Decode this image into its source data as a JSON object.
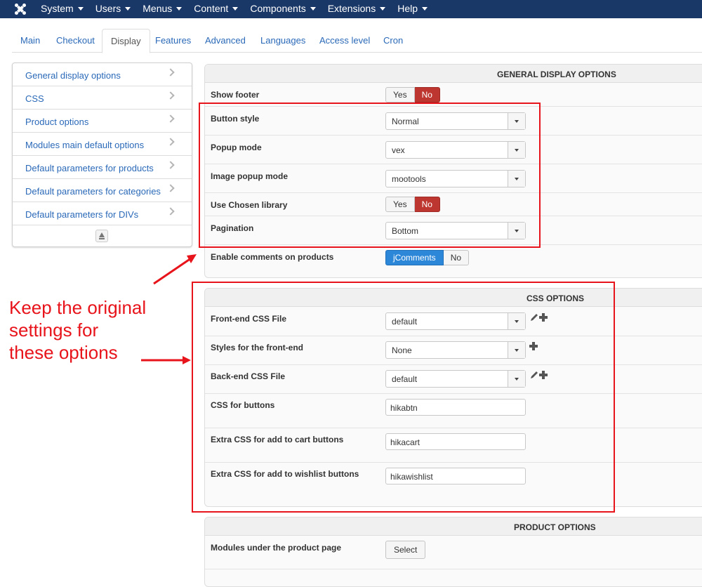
{
  "topbar": {
    "menu": [
      "System",
      "Users",
      "Menus",
      "Content",
      "Components",
      "Extensions",
      "Help"
    ]
  },
  "tabs": [
    "Main",
    "Checkout",
    "Display",
    "Features",
    "Advanced",
    "Languages",
    "Access level",
    "Cron"
  ],
  "active_tab": "Display",
  "sidebar": {
    "items": [
      "General display options",
      "CSS",
      "Product options",
      "Modules main default options",
      "Default parameters for products",
      "Default parameters for categories",
      "Default parameters for DIVs"
    ]
  },
  "general": {
    "title": "GENERAL DISPLAY OPTIONS",
    "show_footer": {
      "label": "Show footer",
      "yes": "Yes",
      "no": "No",
      "selected": "No"
    },
    "button_style": {
      "label": "Button style",
      "value": "Normal"
    },
    "popup_mode": {
      "label": "Popup mode",
      "value": "vex"
    },
    "image_popup_mode": {
      "label": "Image popup mode",
      "value": "mootools"
    },
    "use_chosen": {
      "label": "Use Chosen library",
      "yes": "Yes",
      "no": "No",
      "selected": "No"
    },
    "pagination": {
      "label": "Pagination",
      "value": "Bottom"
    },
    "enable_comments": {
      "label": "Enable comments on products",
      "opt1": "jComments",
      "opt2": "No",
      "selected": "jComments"
    }
  },
  "css": {
    "title": "CSS OPTIONS",
    "frontend_css": {
      "label": "Front-end CSS File",
      "value": "default"
    },
    "frontend_styles": {
      "label": "Styles for the front-end",
      "value": "None"
    },
    "backend_css": {
      "label": "Back-end CSS File",
      "value": "default"
    },
    "css_buttons": {
      "label": "CSS for buttons",
      "value": "hikabtn"
    },
    "css_cart": {
      "label": "Extra CSS for add to cart buttons",
      "value": "hikacart"
    },
    "css_wishlist": {
      "label": "Extra CSS for add to wishlist buttons",
      "value": "hikawishlist"
    }
  },
  "product": {
    "title": "PRODUCT OPTIONS",
    "modules_under": {
      "label": "Modules under the product page",
      "button": "Select"
    }
  },
  "annotation": {
    "lines": [
      "Keep the original",
      "settings for",
      "these options"
    ],
    "color": "#e8141b"
  },
  "colors": {
    "topbar": "#1a3867",
    "link": "#2a69b8",
    "no_active": "#bd362f",
    "jcomments_active": "#2d87d8"
  }
}
